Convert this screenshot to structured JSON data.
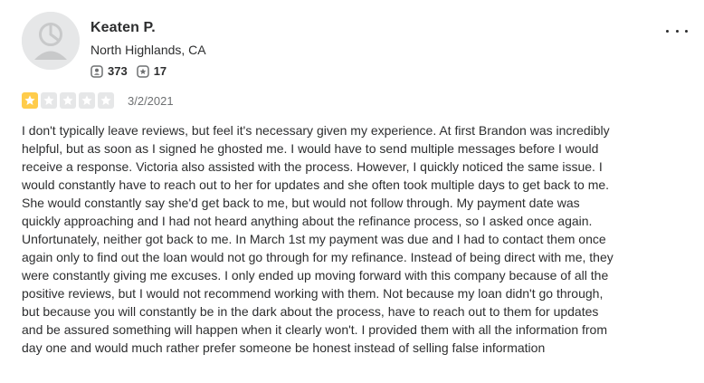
{
  "user": {
    "name": "Keaten P.",
    "location": "North Highlands, CA",
    "friends_count": "373",
    "reviews_count": "17"
  },
  "rating": {
    "value": 1,
    "max": 5,
    "filled_color": "#ffcc4b",
    "empty_color": "#e6e7e8"
  },
  "review": {
    "date": "3/2/2021",
    "text": "I don't typically leave reviews, but feel it's necessary given my experience. At first Brandon was incredibly helpful, but as soon as I signed he ghosted me. I would have to send multiple messages before I would receive a response. Victoria also assisted with the process. However, I quickly noticed the same issue. I would constantly have to reach out to her for updates and she often took multiple days to get back to me. She would constantly say she'd get back to me, but would not follow through. My payment date was quickly approaching and I had not heard anything about the refinance process, so I asked once again.  Unfortunately, neither got back to me. In March 1st my payment was due and I had to contact them once again only to find out the loan would not go through for my refinance. Instead of being direct with me, they were constantly giving me excuses. I only ended up moving forward with this company because of all the positive reviews, but I would not recommend working with them. Not because my loan didn't go through, but because you will constantly be in the dark about the process, have to reach out to them for updates and be assured something will happen when it clearly won't. I provided them with all the information from day one and would much rather prefer someone be honest instead of selling false information"
  },
  "icons": {
    "avatar": "default-user-avatar-icon",
    "friends": "friends-icon",
    "reviews": "review-star-icon",
    "more": "more-options-icon",
    "star": "star-icon"
  }
}
